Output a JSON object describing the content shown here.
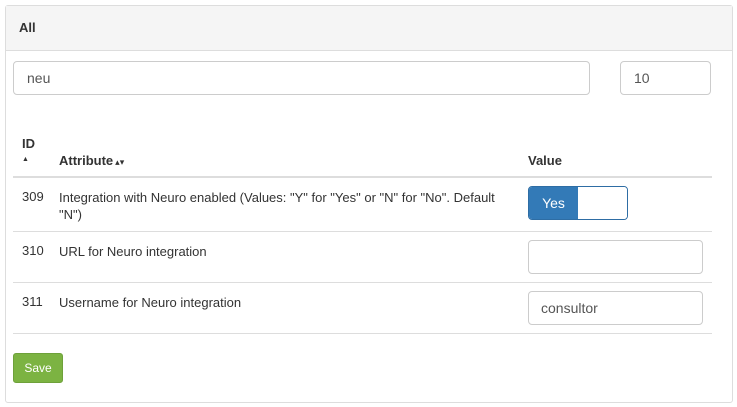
{
  "panel": {
    "title": "All"
  },
  "filter": {
    "search_value": "neu",
    "page_size_value": "10"
  },
  "table": {
    "headers": {
      "id": "ID",
      "attribute": "Attribute",
      "value": "Value"
    },
    "rows": [
      {
        "id": "309",
        "attribute": "Integration with Neuro enabled (Values: \"Y\" for \"Yes\" or \"N\" for \"No\". Default \"N\")",
        "control": "switch",
        "switch_label": "Yes"
      },
      {
        "id": "310",
        "attribute": "URL for Neuro integration",
        "control": "text",
        "value": ""
      },
      {
        "id": "311",
        "attribute": "Username for Neuro integration",
        "control": "text",
        "value": "consultor"
      }
    ]
  },
  "actions": {
    "save_label": "Save"
  },
  "colors": {
    "switch_on": "#337ab7",
    "save_button": "#7cb342",
    "panel_heading_bg": "#f5f5f5"
  }
}
